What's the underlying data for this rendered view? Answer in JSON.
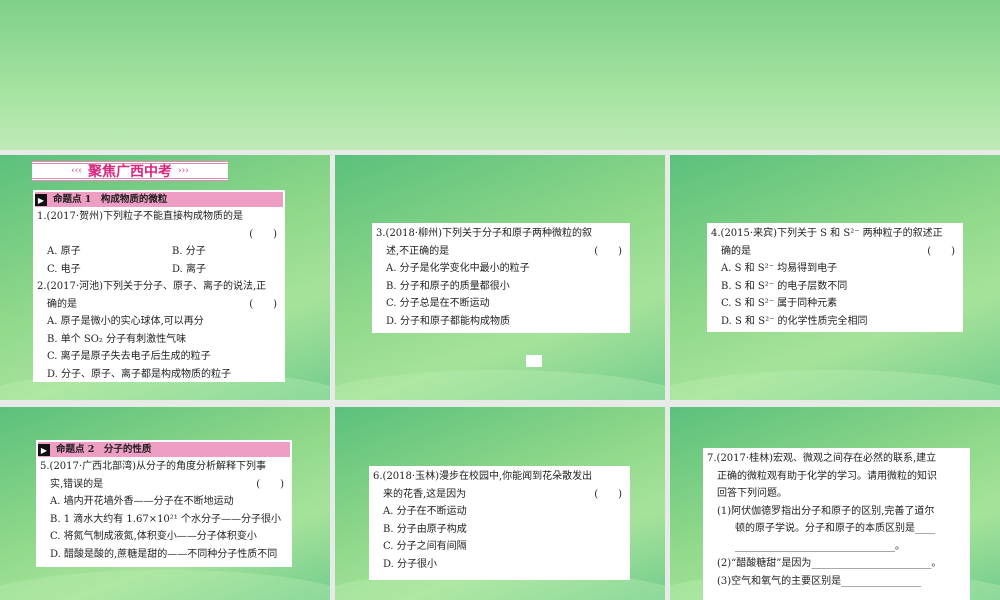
{
  "slides": [
    {
      "banner": "聚焦广西中考",
      "banner_left": "‹‹‹",
      "banner_right": "›››",
      "section": "命题点 1　构成物质的微粒",
      "q1": {
        "stem": "1.(2017·贺州)下列粒子不能直接构成物质的是",
        "paren": "(　　)",
        "A": "A. 原子",
        "B": "B. 分子",
        "C": "C. 电子",
        "D": "D. 离子"
      },
      "q2": {
        "stem1": "2.(2017·河池)下列关于分子、原子、离子的说法,正",
        "stem2": "确的是",
        "paren": "(　　)",
        "A": "A. 原子是微小的实心球体,可以再分",
        "B": "B. 单个 SO₂ 分子有刺激性气味",
        "C": "C. 离子是原子失去电子后生成的粒子",
        "D": "D. 分子、原子、离子都是构成物质的粒子"
      }
    },
    {
      "stem1": "3.(2018·柳州)下列关于分子和原子两种微粒的叙",
      "stem2": "述,不正确的是",
      "paren": "(　　)",
      "A": "A. 分子是化学变化中最小的粒子",
      "B": "B. 分子和原子的质量都很小",
      "C": "C. 分子总是在不断运动",
      "D": "D. 分子和原子都能构成物质"
    },
    {
      "stem1": "4.(2015·来宾)下列关于 S 和 S²⁻ 两种粒子的叙述正",
      "stem2": "确的是",
      "paren": "(　　)",
      "A": "A. S 和 S²⁻ 均易得到电子",
      "B": "B. S 和 S²⁻ 的电子层数不同",
      "C": "C. S 和 S²⁻ 属于同种元素",
      "D": "D. S 和 S²⁻ 的化学性质完全相同"
    },
    {
      "section": "命题点 2　分子的性质",
      "stem1": "5.(2017·广西北部湾)从分子的角度分析解释下列事",
      "stem2": "实,错误的是",
      "paren": "(　　)",
      "A": "A. 墙内开花墙外香——分子在不断地运动",
      "B": "B. 1 滴水大约有 1.67×10²¹ 个水分子——分子很小",
      "C": "C. 将氮气制成液氮,体积变小——分子体积变小",
      "D": "D. 醋酸是酸的,蔗糖是甜的——不同种分子性质不同"
    },
    {
      "stem1": "6.(2018·玉林)漫步在校园中,你能闻到花朵散发出",
      "stem2": "来的花香,这是因为",
      "paren": "(　　)",
      "A": "A. 分子在不断运动",
      "B": "B. 分子由原子构成",
      "C": "C. 分子之间有间隔",
      "D": "D. 分子很小"
    },
    {
      "l1": "7.(2017·桂林)宏观、微观之间存在必然的联系,建立",
      "l2": "正确的微粒观有助于化学的学习。请用微粒的知识",
      "l3": "回答下列问题。",
      "l4": "(1)阿伏伽德罗指出分子和原子的区别,完善了道尔",
      "l5": "顿的原子学说。分子和原子的本质区别是____",
      "l6": "________________________________。",
      "l7": "(2)“醋酸糖甜”是因为________________________。",
      "l8": "(3)空气和氧气的主要区别是________________"
    }
  ]
}
